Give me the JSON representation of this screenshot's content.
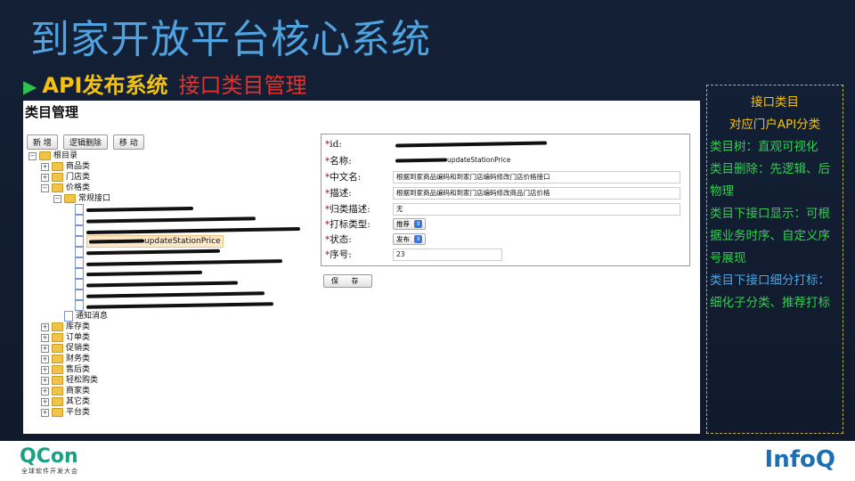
{
  "title": "到家开放平台核心系统",
  "subtitle": {
    "arrow": "▶",
    "part1": "API发布系统",
    "part2": "接口类目管理"
  },
  "screenshot": {
    "heading": "类目管理",
    "toolbar": [
      "新 增",
      "逻辑删除",
      "移 动"
    ],
    "tree": {
      "root": "根目录",
      "top_level_before": [
        "商品类",
        "门店类",
        "价格类"
      ],
      "price_child": "常规接口",
      "selected_method": "updateStationPrice",
      "notice": "通知消息",
      "top_level_after": [
        "库存类",
        "订单类",
        "促销类",
        "财务类",
        "售后类",
        "轻松购类",
        "商家类",
        "其它类",
        "平台类"
      ]
    },
    "form": {
      "labels": {
        "id": "id:",
        "name": "名称:",
        "cn_name": "中文名:",
        "desc": "描述:",
        "category_desc": "归类描述:",
        "tag_type": "打标类型:",
        "status": "状态:",
        "order": "序号:"
      },
      "name_value_suffix": "updateStationPrice",
      "cn_name_value": "根据到家商品编码和到家门店编码修改门店价格接口",
      "desc_value": "根据到家商品编码和到家门店编码修改商品门店价格",
      "category_desc_value": "无",
      "tag_type_value": "推荐",
      "status_value": "发布",
      "order_value": "23",
      "required_mark": "*"
    },
    "save_label": "保 存"
  },
  "sidebar": {
    "lines": [
      {
        "text": "接口类目",
        "style": "c"
      },
      {
        "text": "对应门户API分类",
        "style": "c"
      },
      {
        "text": "类目树：直观可视化",
        "style": "g"
      },
      {
        "text": "类目删除：先逻辑、后",
        "style": "g"
      },
      {
        "text": "物理",
        "style": "g"
      },
      {
        "text": "类目下接口显示：可根",
        "style": "g"
      },
      {
        "text": "据业务时序、自定义序",
        "style": "g"
      },
      {
        "text": "号展现",
        "style": "g"
      },
      {
        "text": "类目下接口细分打标：",
        "style": "b"
      },
      {
        "text": "细化子分类、推荐打标",
        "style": "g"
      }
    ]
  },
  "footer": {
    "qcon": "QCon",
    "qcon_sub": "全球软件开发大会",
    "infoq": "InfoQ"
  },
  "colors": {
    "title": "#4fa3e0",
    "accent_yellow": "#f4c20d",
    "accent_red": "#e5322d",
    "green": "#30d04f"
  }
}
